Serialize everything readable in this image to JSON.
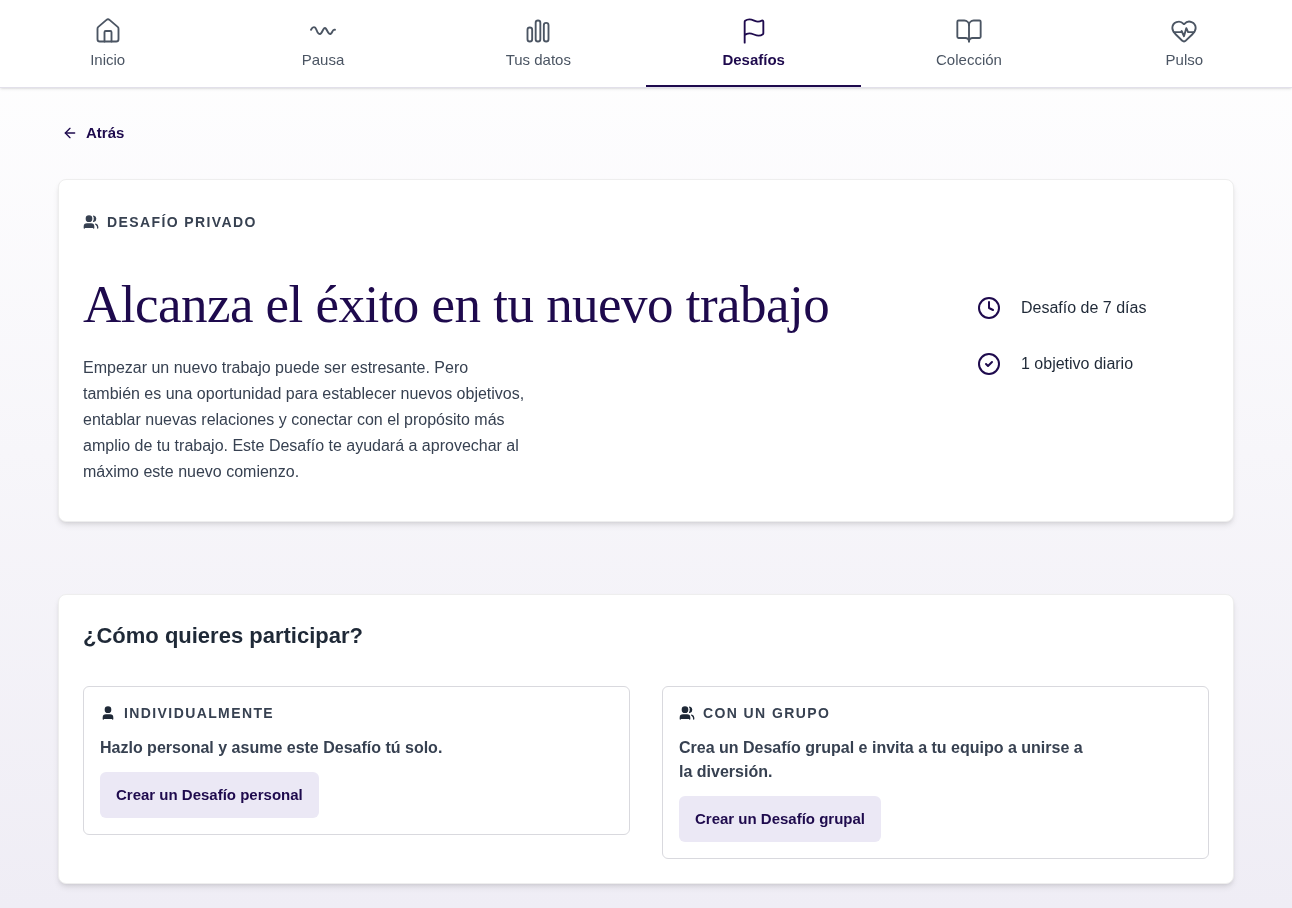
{
  "nav": {
    "tabs": [
      {
        "kind": "home",
        "label": "Inicio",
        "selected": false
      },
      {
        "kind": "wave",
        "label": "Pausa",
        "selected": false
      },
      {
        "kind": "bars",
        "label": "Tus datos",
        "selected": false
      },
      {
        "kind": "flag",
        "label": "Desafíos",
        "selected": true
      },
      {
        "kind": "book",
        "label": "Colección",
        "selected": false
      },
      {
        "kind": "heart",
        "label": "Pulso",
        "selected": false
      }
    ]
  },
  "back_link": "Atrás",
  "challenge": {
    "tag": "DESAFÍO PRIVADO",
    "title": "Alcanza el éxito en tu nuevo trabajo",
    "description": "Empezar un nuevo trabajo puede ser estresante. Pero también es una oportunidad para establecer nuevos objetivos, entablar nuevas relaciones y conectar con el propósito más amplio de tu trabajo. Este Desafío te ayudará a aprovechar al máximo este nuevo comienzo.",
    "facts": [
      {
        "kind": "duration",
        "text": "Desafío de 7 días"
      },
      {
        "kind": "goal",
        "text": "1 objetivo diario"
      }
    ]
  },
  "participation": {
    "heading": "¿Cómo quieres participar?",
    "options": [
      {
        "kind": "individual",
        "label": "INDIVIDUALMENTE",
        "text": "Hazlo personal y asume este Desafío tú solo.",
        "button": "Crear un Desafío personal"
      },
      {
        "kind": "group",
        "label": "CON UN GRUPO",
        "text": "Crea un Desafío grupal e invita a tu equipo a unirse a la diversión.",
        "button": "Crear un Desafío grupal"
      }
    ]
  }
}
